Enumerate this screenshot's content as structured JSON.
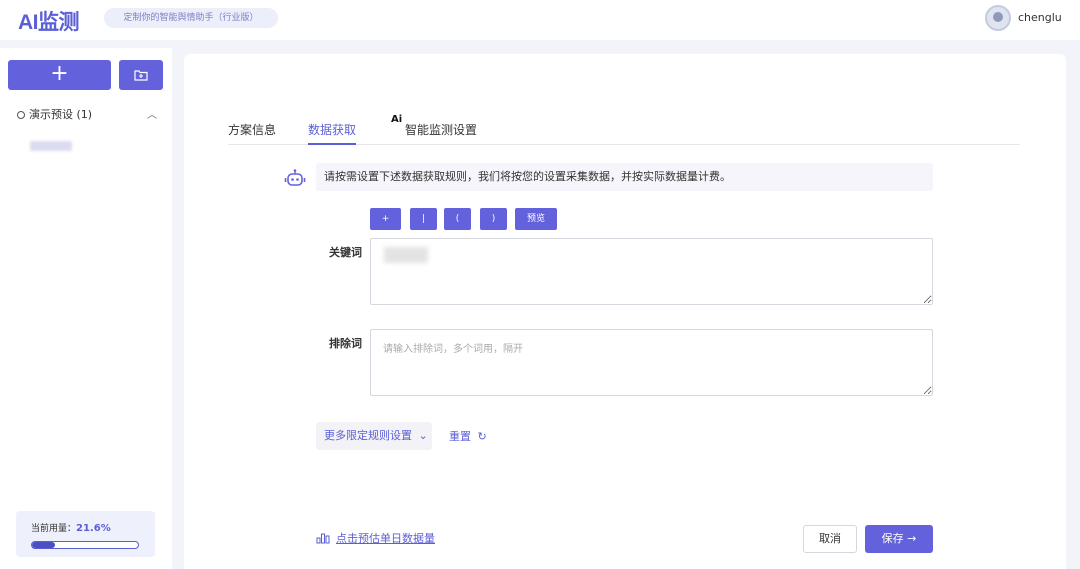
{
  "header": {
    "logo": "AI监测",
    "tagline": "定制你的智能舆情助手（行业版）",
    "username": "chenglu"
  },
  "sidebar": {
    "add_button": "+",
    "preset_group": "演示预设 (1)",
    "usage_label": "当前用量：",
    "usage_value": "21.6%",
    "usage_fraction": 0.216
  },
  "main": {
    "tabs": [
      {
        "label": "方案信息"
      },
      {
        "label": "数据获取",
        "active": true
      },
      {
        "label": "智能监测设置",
        "badge": "Ai"
      }
    ],
    "notice": "请按需设置下述数据获取规则，我们将按您的设置采集数据，并按实际数据量计费。",
    "operators": [
      "+",
      "|",
      "(",
      ")",
      "预览"
    ],
    "keyword_label": "关键词",
    "exclude_label": "排除词",
    "exclude_placeholder": "请输入排除词，多个词用，隔开",
    "more_rules": "更多限定规则设置",
    "reset": "重置",
    "estimate": "点击预估单日数据量",
    "cancel": "取消",
    "save": "保存 →"
  },
  "colors": {
    "accent": "#6461dc",
    "accent_text": "#5b5fd6"
  }
}
